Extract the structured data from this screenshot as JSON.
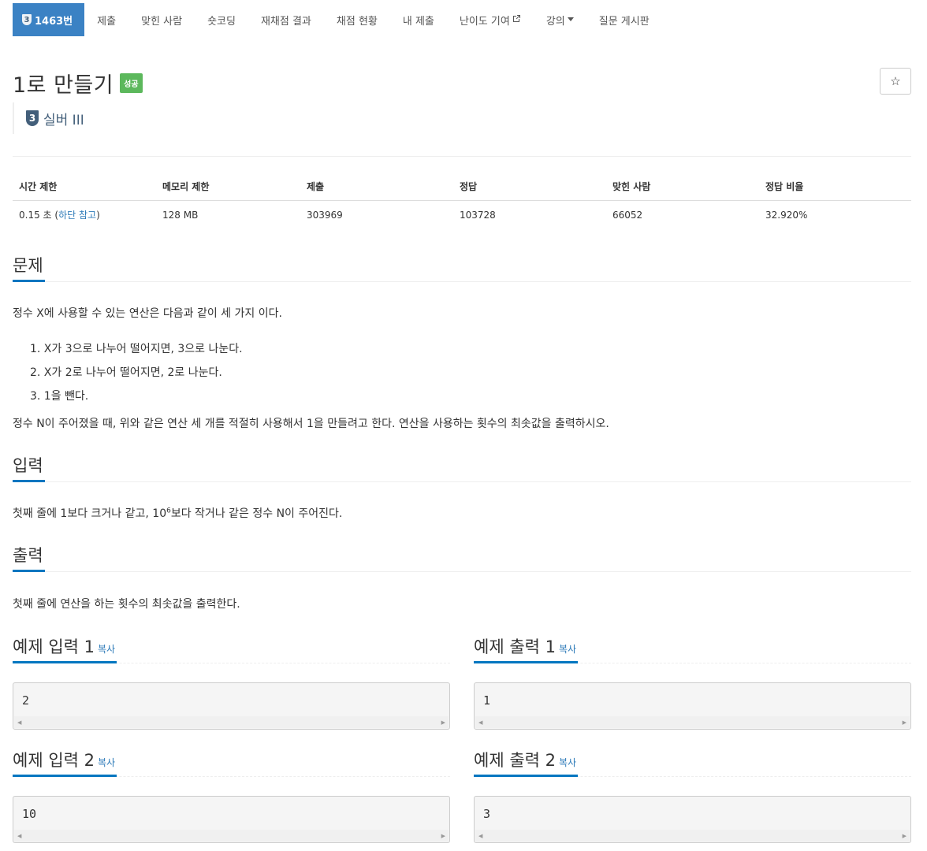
{
  "nav": {
    "problem_tab": {
      "tier_num": "3",
      "label": "1463번"
    },
    "tabs": [
      "제출",
      "맞힌 사람",
      "숏코딩",
      "재채점 결과",
      "채점 현황",
      "내 제출"
    ],
    "contrib_label": "난이도 기여",
    "contrib_icon": "external-link-icon",
    "lecture_label": "강의",
    "lecture_icon": "caret-down-icon",
    "board_label": "질문 게시판"
  },
  "problem": {
    "title": "1로 만들기",
    "status_badge": "성공",
    "star_icon": "☆",
    "tier_num": "3",
    "tier_label": "실버 III"
  },
  "info_table": {
    "headers": [
      "시간 제한",
      "메모리 제한",
      "제출",
      "정답",
      "맞힌 사람",
      "정답 비율"
    ],
    "time_limit": "0.15 초 ",
    "time_note_open": "(",
    "time_note_link": "하단 참고",
    "time_note_close": ")",
    "memory": "128 MB",
    "submissions": "303969",
    "accepted": "103728",
    "solvers": "66052",
    "ratio": "32.920%"
  },
  "sections": {
    "description": {
      "title": "문제",
      "intro": "정수 X에 사용할 수 있는 연산은 다음과 같이 세 가지 이다.",
      "steps": [
        "1. X가 3으로 나누어 떨어지면, 3으로 나눈다.",
        "2. X가 2로 나누어 떨어지면, 2로 나눈다.",
        "3. 1을 뺀다."
      ],
      "outro": "정수 N이 주어졌을 때, 위와 같은 연산 세 개를 적절히 사용해서 1을 만들려고 한다. 연산을 사용하는 횟수의 최솟값을 출력하시오."
    },
    "input": {
      "title": "입력",
      "text_before": "첫째 줄에 1보다 크거나 같고, 10",
      "sup": "6",
      "text_after": "보다 작거나 같은 정수 N이 주어진다."
    },
    "output": {
      "title": "출력",
      "text": "첫째 줄에 연산을 하는 횟수의 최솟값을 출력한다."
    }
  },
  "samples": {
    "copy_label": "복사",
    "items": [
      {
        "input_title": "예제 입력 1",
        "input": "2",
        "output_title": "예제 출력 1",
        "output": "1"
      },
      {
        "input_title": "예제 입력 2",
        "input": "10",
        "output_title": "예제 출력 2",
        "output": "3"
      }
    ]
  }
}
